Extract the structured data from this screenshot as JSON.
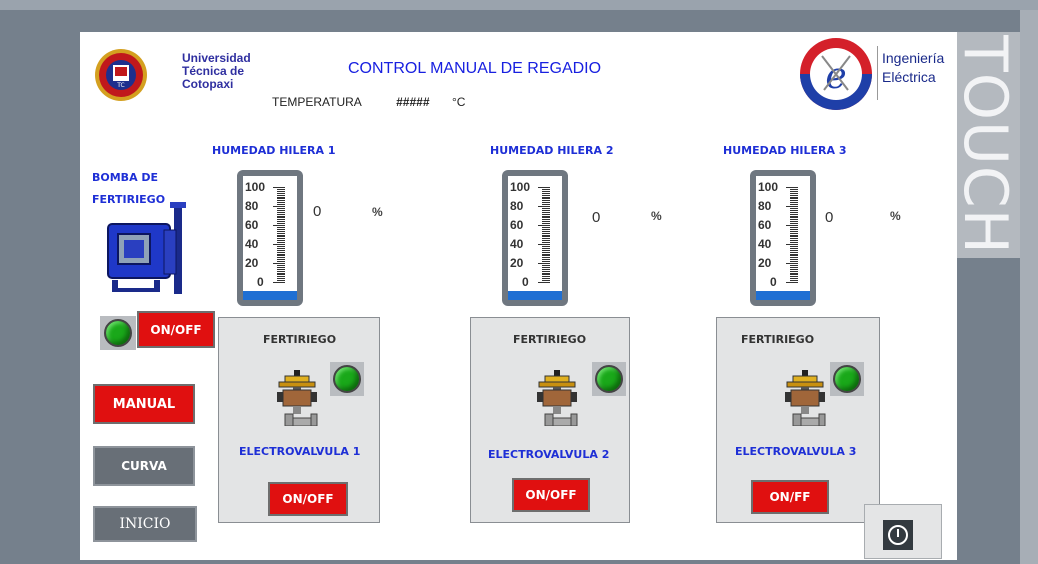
{
  "header": {
    "title": "CONTROL MANUAL DE REGADIO",
    "university": [
      "Universidad",
      "Técnica de",
      "Cotopaxi"
    ],
    "department": [
      "Ingeniería",
      "Eléctrica"
    ],
    "temperature_label": "TEMPERATURA",
    "temperature_value": "#####",
    "temperature_unit": "°C",
    "side_label": "TOUCH"
  },
  "pump": {
    "label_line1": "BOMBA DE",
    "label_line2": "FERTIRIEGO",
    "button": "ON/OFF"
  },
  "nav": {
    "manual": "MANUAL",
    "curva": "CURVA",
    "inicio": "INICIO"
  },
  "gauge_scale": [
    "100",
    "80",
    "60",
    "40",
    "20",
    "0"
  ],
  "rows": [
    {
      "humidity_label": "HUMEDAD HILERA 1",
      "value": "0",
      "unit": "%",
      "level": 0,
      "panel_title": "FERTIRIEGO",
      "valve_label": "ELECTROVALVULA 1",
      "button": "ON/OFF"
    },
    {
      "humidity_label": "HUMEDAD HILERA 2",
      "value": "0",
      "unit": "%",
      "level": 0,
      "panel_title": "FERTIRIEGO",
      "valve_label": "ELECTROVALVULA 2",
      "button": "ON/OFF"
    },
    {
      "humidity_label": "HUMEDAD HILERA 3",
      "value": "0",
      "unit": "%",
      "level": 0,
      "panel_title": "FERTIRIEGO",
      "valve_label": "ELECTROVALVULA 3",
      "button": "ON/FF"
    }
  ],
  "colors": {
    "background": "#75808c",
    "title_blue": "#1820e0",
    "button_red": "#e01010",
    "indicator_green": "#1aa81a",
    "gauge_fill": "#1f6fd3"
  }
}
